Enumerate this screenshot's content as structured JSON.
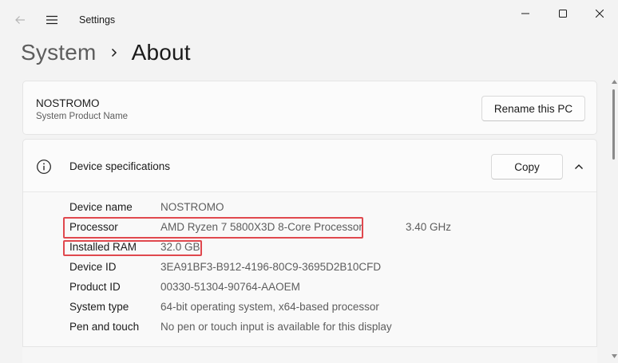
{
  "window": {
    "app_title": "Settings",
    "icons": {
      "back": "back-arrow-icon",
      "menu": "hamburger-menu-icon",
      "minimize": "minimize-icon",
      "maximize": "maximize-icon",
      "close": "close-icon"
    }
  },
  "breadcrumb": {
    "parent": "System",
    "current": "About",
    "separator_icon": "chevron-right-icon"
  },
  "pc": {
    "name": "NOSTROMO",
    "subtitle": "System Product Name",
    "rename_label": "Rename this PC"
  },
  "specs": {
    "title": "Device specifications",
    "icon": "info-icon",
    "copy_label": "Copy",
    "collapse_icon": "chevron-up-icon",
    "rows": [
      {
        "label": "Device name",
        "value": "NOSTROMO",
        "extra": ""
      },
      {
        "label": "Processor",
        "value": "AMD Ryzen 7 5800X3D 8-Core Processor",
        "extra": "3.40 GHz"
      },
      {
        "label": "Installed RAM",
        "value": "32.0 GB",
        "extra": ""
      },
      {
        "label": "Device ID",
        "value": "3EA91BF3-B912-4196-80C9-3695D2B10CFD",
        "extra": ""
      },
      {
        "label": "Product ID",
        "value": "00330-51304-90764-AAOEM",
        "extra": ""
      },
      {
        "label": "System type",
        "value": "64-bit operating system, x64-based processor",
        "extra": ""
      },
      {
        "label": "Pen and touch",
        "value": "No pen or touch input is available for this display",
        "extra": ""
      }
    ]
  },
  "colors": {
    "highlight_box": "#e0484e",
    "background": "#f3f3f3",
    "card": "#fbfbfb"
  }
}
